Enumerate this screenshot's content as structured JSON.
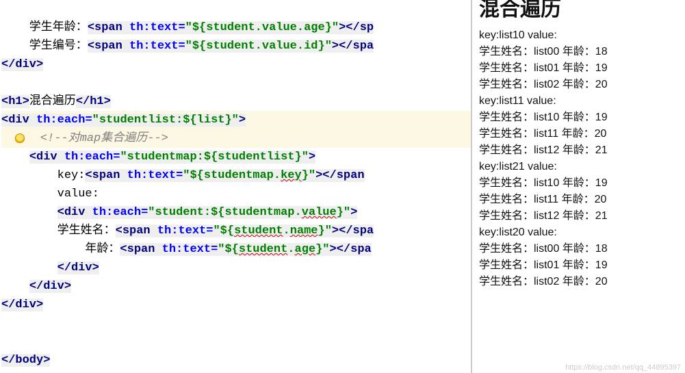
{
  "code": {
    "l0_a": "    学生年龄：",
    "l0_b": "${student.value.age}",
    "l1_a": "    学生编号：",
    "l1_b": "${student.value.id}",
    "l2": "</",
    "l2_div": "div",
    "empty": "",
    "h1_open": "<",
    "h1_name": "h1",
    "h1_txt": "混合遍历",
    "h1_close": "</",
    "div_open": "<",
    "div_name": "div",
    "each_attr": "th:each",
    "each_val1": "\"studentlist:${list}\"",
    "cmt": "<!--对map集合遍历-->",
    "each_val2": "\"studentmap:${studentlist}\"",
    "key_label": "        key:",
    "span_name": "span",
    "text_attr": "th:text",
    "key_expr": "\"${studentmap.key}\"",
    "value_label": "        value:",
    "each_val3": "\"student:${studentmap.value}\"",
    "name_label": "        学生姓名：",
    "name_expr": "\"${student.name}\"",
    "age_label": "            年龄：",
    "age_expr": "\"${student.age}\"",
    "body_close": "body",
    "wavy_key": "key",
    "wavy_value": "value",
    "wavy_name": "name",
    "wavy_student": "student",
    "wavy_age": "age"
  },
  "output": {
    "heading": "混合遍历",
    "groups": [
      {
        "key": "list10",
        "rows": [
          {
            "name": "list00",
            "age": "18"
          },
          {
            "name": "list01",
            "age": "19"
          },
          {
            "name": "list02",
            "age": "20"
          }
        ]
      },
      {
        "key": "list11",
        "rows": [
          {
            "name": "list10",
            "age": "19"
          },
          {
            "name": "list11",
            "age": "20"
          },
          {
            "name": "list12",
            "age": "21"
          }
        ]
      },
      {
        "key": "list21",
        "rows": [
          {
            "name": "list10",
            "age": "19"
          },
          {
            "name": "list11",
            "age": "20"
          },
          {
            "name": "list12",
            "age": "21"
          }
        ]
      },
      {
        "key": "list20",
        "rows": [
          {
            "name": "list00",
            "age": "18"
          },
          {
            "name": "list01",
            "age": "19"
          },
          {
            "name": "list02",
            "age": "20"
          }
        ]
      }
    ],
    "labels": {
      "key_prefix": "key:",
      "value_suffix": " value:",
      "name": "学生姓名：",
      "age": " 年龄："
    }
  },
  "watermark": "https://blog.csdn.net/qq_44895397"
}
